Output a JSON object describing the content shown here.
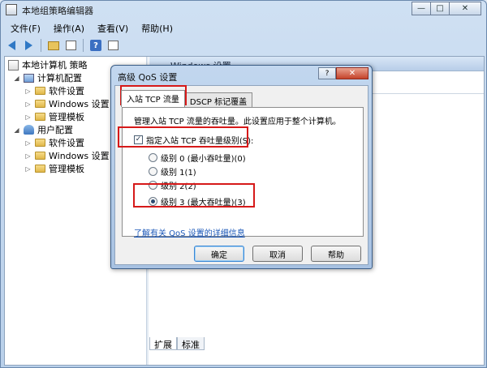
{
  "app": {
    "title": "本地组策略编辑器",
    "window_controls": {
      "minimize": "—",
      "maximize": "□",
      "close": "✕"
    }
  },
  "menu": [
    "文件(F)",
    "操作(A)",
    "查看(V)",
    "帮助(H)"
  ],
  "toolbar": {
    "icons": [
      "back-arrow-icon",
      "forward-arrow-icon",
      "folder-up-icon",
      "show-hide-tree-icon",
      "help-icon",
      "properties-icon"
    ]
  },
  "tree": {
    "root": "本地计算机 策略",
    "computer_config": "计算机配置",
    "computer_children": [
      "软件设置",
      "Windows 设置",
      "管理模板"
    ],
    "user_config": "用户配置",
    "user_children": [
      "软件设置",
      "Windows 设置",
      "管理模板"
    ]
  },
  "right_pane": {
    "header": "Windows 设置"
  },
  "bottom_tabs": [
    "扩展",
    "标准"
  ],
  "dialog": {
    "title": "高级 QoS 设置",
    "help_button": "?",
    "close_button": "✕",
    "tabs": [
      "入站 TCP 流量",
      "DSCP 标记覆盖"
    ],
    "description": "管理入站 TCP 流量的吞吐量。此设置应用于整个计算机。",
    "checkbox": {
      "label": "指定入站 TCP 吞吐量级别(S):",
      "checked": true,
      "mark": "✓"
    },
    "options": [
      {
        "label": "级别 0 (最小吞吐量)(0)",
        "selected": false
      },
      {
        "label": "级别 1(1)",
        "selected": false
      },
      {
        "label": "级别 2(2)",
        "selected": false
      },
      {
        "label": "级别 3 (最大吞吐量)(3)",
        "selected": true
      }
    ],
    "link": "了解有关 QoS 设置的详细信息",
    "buttons": {
      "ok": "确定",
      "cancel": "取消",
      "help": "帮助"
    }
  },
  "colors": {
    "highlight": "#d61919",
    "link": "#1a57b8",
    "title_gradient_top": "#c2d7ef"
  }
}
